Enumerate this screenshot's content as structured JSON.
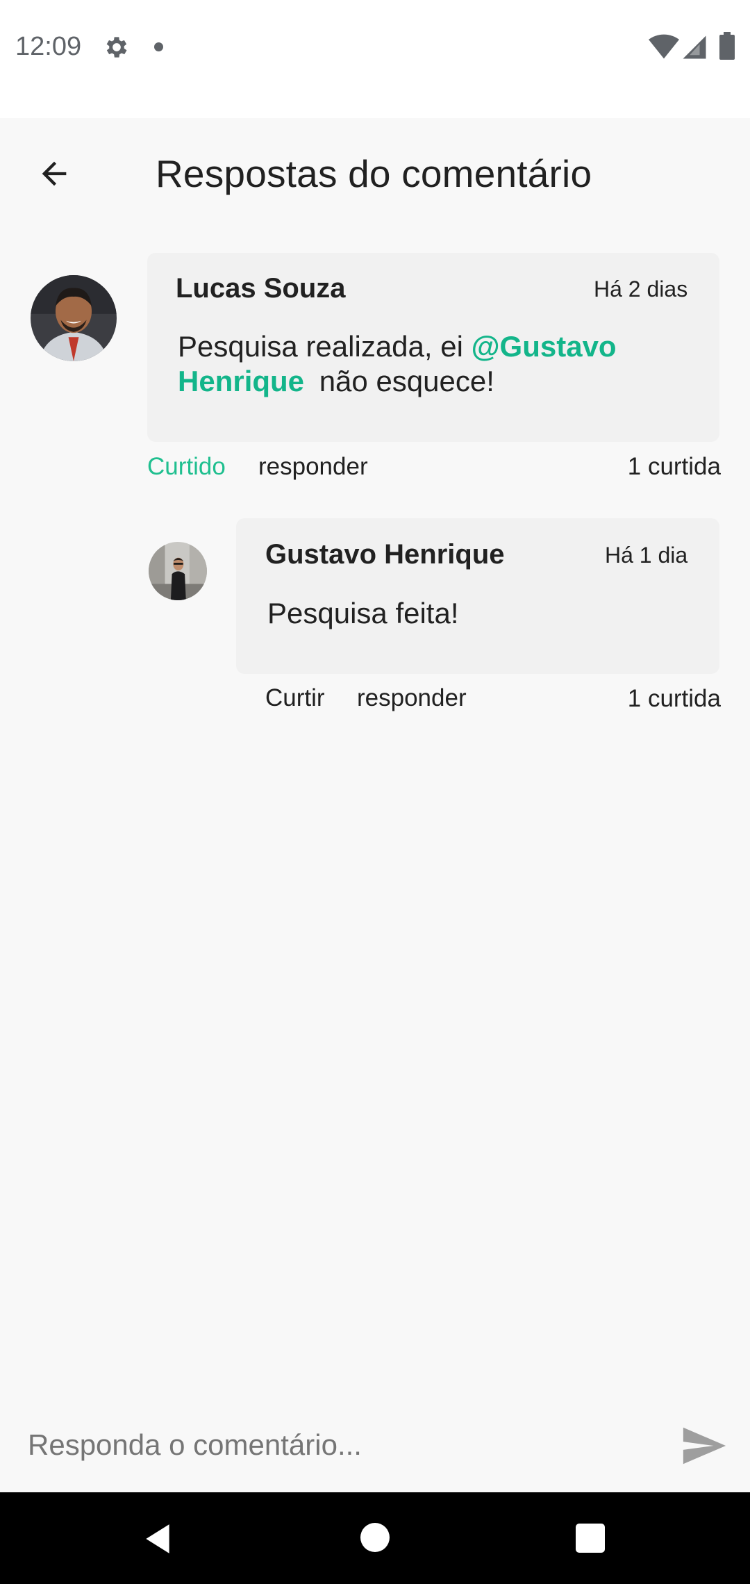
{
  "status_bar": {
    "time": "12:09",
    "icons": [
      "gear-icon",
      "dot-icon",
      "wifi-icon",
      "signal-icon",
      "battery-icon"
    ]
  },
  "header": {
    "title": "Respostas do comentário",
    "back_icon": "arrow-back-icon"
  },
  "comment": {
    "author": "Lucas Souza",
    "time": "Há 2 dias",
    "text_before": "Pesquisa realizada, ei ",
    "mention_line1": "@Gustavo",
    "mention_line2": "Henrique",
    "text_after": " não esquece!",
    "like_label": "Curtido",
    "reply_label": "responder",
    "likes": "1 curtida"
  },
  "reply": {
    "author": "Gustavo Henrique",
    "time": "Há 1 dia",
    "text": "Pesquisa feita!",
    "like_label": "Curtir",
    "reply_label": "responder",
    "likes": "1 curtida"
  },
  "composer": {
    "placeholder": "Responda o comentário...",
    "send_icon": "send-icon"
  },
  "colors": {
    "accent": "#13b58a",
    "bubble": "#f1f1f1",
    "background": "#f8f8f8"
  }
}
